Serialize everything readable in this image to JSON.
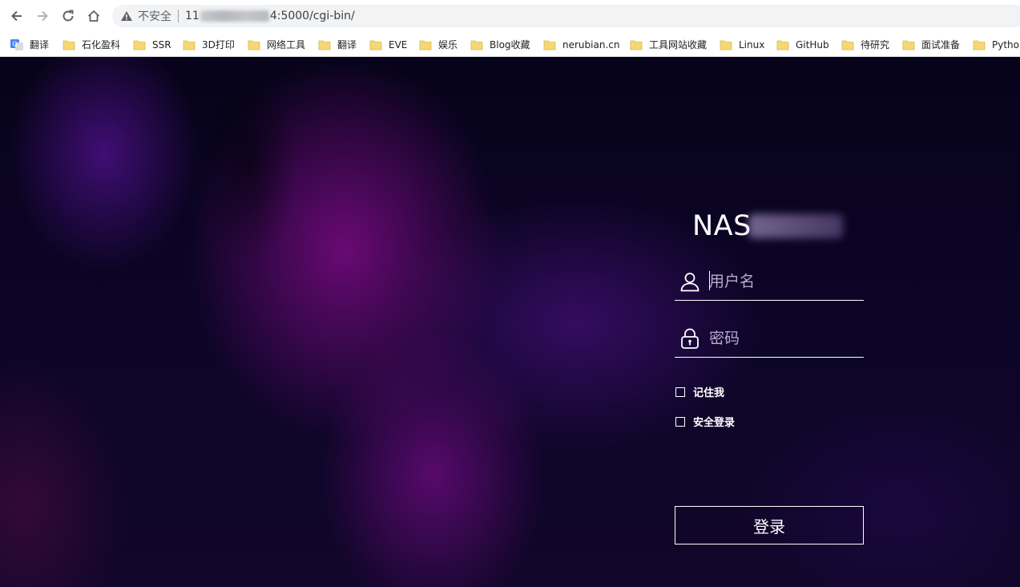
{
  "browser": {
    "security_label": "不安全",
    "url_prefix": "11",
    "url_suffix": "4:5000/cgi-bin/",
    "icons": {
      "back": "arrow-left-icon",
      "forward": "arrow-right-icon",
      "reload": "reload-icon",
      "home": "home-icon",
      "security": "warning-icon"
    }
  },
  "bookmarks": [
    {
      "label": "翻译",
      "icon": "google-translate-icon"
    },
    {
      "label": "石化盈科",
      "icon": "folder-icon"
    },
    {
      "label": "SSR",
      "icon": "folder-icon"
    },
    {
      "label": "3D打印",
      "icon": "folder-icon"
    },
    {
      "label": "网络工具",
      "icon": "folder-icon"
    },
    {
      "label": "翻译",
      "icon": "folder-icon"
    },
    {
      "label": "EVE",
      "icon": "folder-icon"
    },
    {
      "label": "娱乐",
      "icon": "folder-icon"
    },
    {
      "label": "Blog收藏",
      "icon": "folder-icon"
    },
    {
      "label": "nerubian.cn",
      "icon": "folder-icon"
    },
    {
      "label": "工具网站收藏",
      "icon": "folder-icon"
    },
    {
      "label": "Linux",
      "icon": "folder-icon"
    },
    {
      "label": "GitHub",
      "icon": "folder-icon"
    },
    {
      "label": "待研究",
      "icon": "folder-icon"
    },
    {
      "label": "面试准备",
      "icon": "folder-icon"
    },
    {
      "label": "Python",
      "icon": "folder-icon"
    }
  ],
  "login": {
    "server_name_visible": "NAS",
    "username_placeholder": "用户名",
    "password_placeholder": "密码",
    "remember_label": "记住我",
    "secure_login_label": "安全登录",
    "submit_label": "登录",
    "icons": {
      "username": "user-icon",
      "password": "lock-icon"
    }
  },
  "colors": {
    "accent": "#ffffff",
    "folder": "#f7d774",
    "background_dark": "#0b0420",
    "background_purple": "#6e0a78"
  }
}
